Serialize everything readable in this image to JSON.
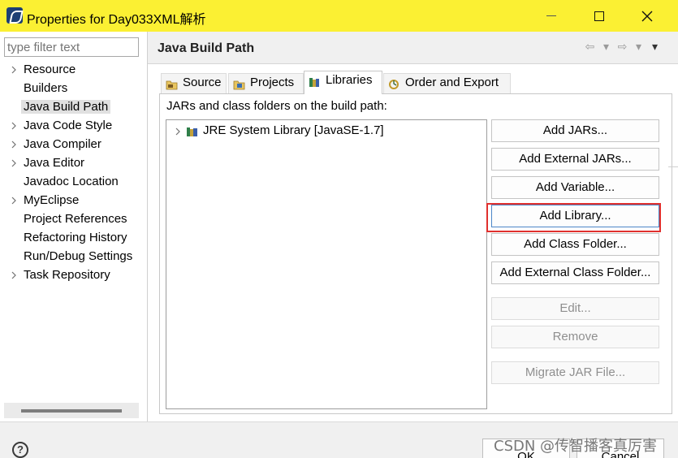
{
  "window": {
    "title": "Properties for Day033XML解析"
  },
  "sidebar": {
    "filter_placeholder": "type filter text",
    "items": [
      {
        "label": "Resource",
        "expandable": true
      },
      {
        "label": "Builders",
        "expandable": false
      },
      {
        "label": "Java Build Path",
        "expandable": false,
        "selected": true
      },
      {
        "label": "Java Code Style",
        "expandable": true
      },
      {
        "label": "Java Compiler",
        "expandable": true
      },
      {
        "label": "Java Editor",
        "expandable": true
      },
      {
        "label": "Javadoc Location",
        "expandable": false
      },
      {
        "label": "MyEclipse",
        "expandable": true
      },
      {
        "label": "Project References",
        "expandable": false
      },
      {
        "label": "Refactoring History",
        "expandable": false
      },
      {
        "label": "Run/Debug Settings",
        "expandable": false
      },
      {
        "label": "Task Repository",
        "expandable": true
      }
    ]
  },
  "page": {
    "title": "Java Build Path",
    "tabs": [
      {
        "label": "Source",
        "icon": "source-folder-icon"
      },
      {
        "label": "Projects",
        "icon": "projects-icon"
      },
      {
        "label": "Libraries",
        "icon": "libraries-icon",
        "active": true
      },
      {
        "label": "Order and Export",
        "icon": "order-export-icon"
      }
    ],
    "path_label": "JARs and class folders on the build path:",
    "libraries": [
      {
        "label": "JRE System Library [JavaSE-1.7]"
      }
    ],
    "buttons": {
      "add_jars": "Add JARs...",
      "add_external_jars": "Add External JARs...",
      "add_variable": "Add Variable...",
      "add_library": "Add Library...",
      "add_class_folder": "Add Class Folder...",
      "add_external_class_folder": "Add External Class Folder...",
      "edit": "Edit...",
      "remove": "Remove",
      "migrate_jar": "Migrate JAR File..."
    }
  },
  "footer": {
    "help": "?",
    "ok": "OK",
    "cancel": "Cancel"
  },
  "watermark": "CSDN @传智播客真厉害",
  "colors": {
    "titlebar": "#fbf033",
    "highlight": "#e0302e"
  }
}
